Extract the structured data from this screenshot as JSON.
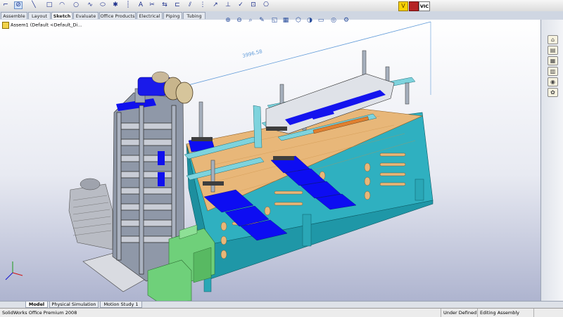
{
  "toolbar": {
    "items": [
      {
        "name": "exit-sketch-icon",
        "glyph": "⌐"
      },
      {
        "name": "smart-dimension-icon",
        "glyph": "⊘"
      },
      {
        "name": "line-icon",
        "glyph": "╲"
      },
      {
        "name": "rectangle-icon",
        "glyph": "□"
      },
      {
        "name": "arc-icon",
        "glyph": "◠"
      },
      {
        "name": "circle-icon",
        "glyph": "○"
      },
      {
        "name": "spline-icon",
        "glyph": "∿"
      },
      {
        "name": "ellipse-icon",
        "glyph": "⬭"
      },
      {
        "name": "point-icon",
        "glyph": "✱"
      },
      {
        "name": "centerline-icon",
        "glyph": "┊"
      },
      {
        "name": "text-icon",
        "glyph": "A"
      },
      {
        "name": "trim-icon",
        "glyph": "✂"
      },
      {
        "name": "convert-icon",
        "glyph": "⇆"
      },
      {
        "name": "offset-icon",
        "glyph": "⊏"
      },
      {
        "name": "mirror-icon",
        "glyph": "⫽"
      },
      {
        "name": "pattern-icon",
        "glyph": "⋮"
      },
      {
        "name": "move-icon",
        "glyph": "↗"
      },
      {
        "name": "relations-icon",
        "glyph": "⊥"
      },
      {
        "name": "repair-icon",
        "glyph": "✓"
      },
      {
        "name": "quick-snaps-icon",
        "glyph": "⊡"
      },
      {
        "name": "rapid-sketch-icon",
        "glyph": "⎔"
      }
    ],
    "right_label": "VIC"
  },
  "tabs": [
    "Assemble",
    "Layout",
    "Sketch",
    "Evaluate",
    "Office Products",
    "Electrical",
    "Piping",
    "Tubing"
  ],
  "active_tab": "Sketch",
  "heads_up": [
    "⊕",
    "⊖",
    "⌕",
    "✎",
    "◱",
    "▦",
    "⬡",
    "◑",
    "▭",
    "◎",
    "⚙"
  ],
  "feature_tree": {
    "root": "Assem1  (Default <Default_Di..."
  },
  "dimension": "3996.58",
  "taskpane": [
    "⌂",
    "▤",
    "▦",
    "▥",
    "◉",
    "✿"
  ],
  "bottom_tabs": [
    "Model",
    "Physical Simulation",
    "Motion Study 1"
  ],
  "active_bottom_tab": "Model",
  "status": {
    "app": "SolidWorks Office Premium 2008",
    "definition": "Under Defined",
    "mode": "Editing Assembly"
  },
  "colors": {
    "blue_parts": "#1010ee",
    "cyan_frame": "#35b2c2",
    "wood": "#e8b779",
    "green_box": "#6fd07a"
  }
}
